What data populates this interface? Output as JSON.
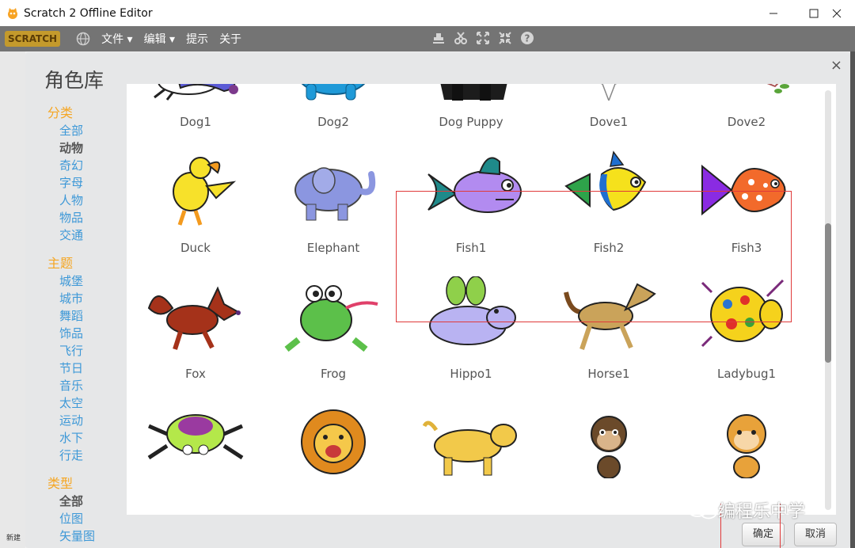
{
  "window": {
    "title": "Scratch 2 Offline Editor",
    "minimize": "_",
    "maximize": "☐",
    "close": "✕"
  },
  "menubar": {
    "logo": "SCRATCH",
    "items": [
      "文件 ▾",
      "编辑 ▾",
      "提示",
      "关于"
    ]
  },
  "dialog": {
    "title": "角色库",
    "close": "×",
    "sidebar": {
      "sections": [
        {
          "heading": "分类",
          "items": [
            "全部",
            "动物",
            "奇幻",
            "字母",
            "人物",
            "物品",
            "交通"
          ],
          "active": "动物"
        },
        {
          "heading": "主题",
          "items": [
            "城堡",
            "城市",
            "舞蹈",
            "饰品",
            "飞行",
            "节日",
            "音乐",
            "太空",
            "运动",
            "水下",
            "行走"
          ]
        },
        {
          "heading": "类型",
          "items": [
            "全部",
            "位图",
            "矢量图"
          ],
          "active": "全部"
        }
      ]
    },
    "sprites": [
      [
        "Dog1",
        "Dog2",
        "Dog Puppy",
        "Dove1",
        "Dove2"
      ],
      [
        "Duck",
        "Elephant",
        "Fish1",
        "Fish2",
        "Fish3"
      ],
      [
        "Fox",
        "Frog",
        "Hippo1",
        "Horse1",
        "Ladybug1"
      ],
      [
        "",
        "",
        "",
        "",
        ""
      ]
    ],
    "buttons": {
      "ok": "确定",
      "cancel": "取消"
    }
  },
  "watermark": "编程乐中学",
  "left_fragment": "新建",
  "colors": {
    "accent_orange": "#f5a623",
    "link_blue": "#3d98d7",
    "selection_red": "#e03a3a",
    "menubar": "#747474"
  }
}
